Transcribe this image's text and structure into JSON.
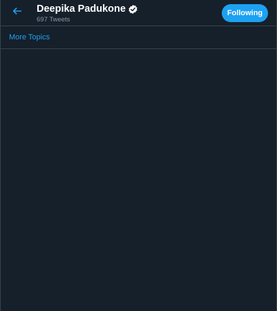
{
  "header": {
    "back_icon": "arrow-left-icon",
    "name": "Deepika Padukone",
    "verified_icon": "verified-badge-icon",
    "tweet_count": "697 Tweets",
    "follow_label": "Following"
  },
  "topics": {
    "link_label": "More Topics"
  },
  "colors": {
    "background": "#15202b",
    "accent": "#1da1f2",
    "border": "#38444d",
    "muted_text": "#8899a6"
  }
}
